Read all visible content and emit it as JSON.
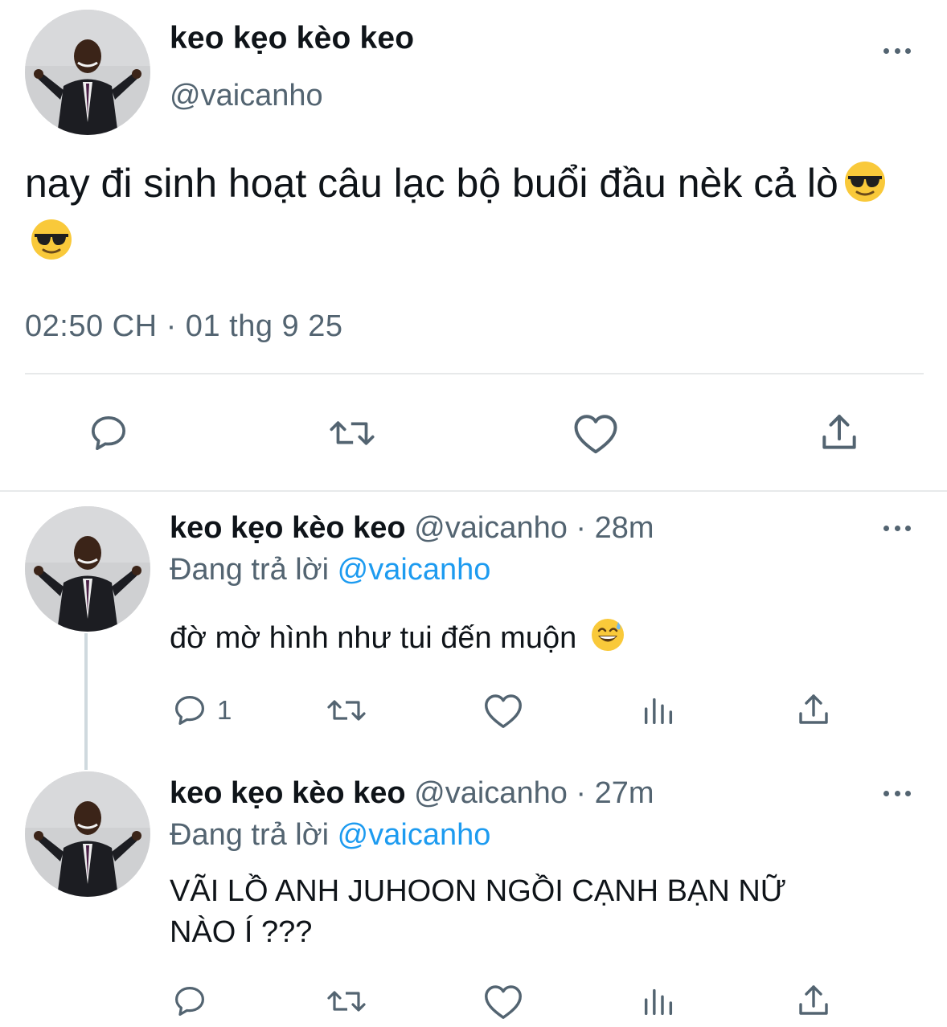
{
  "main_tweet": {
    "display_name": "keo kẹo kèo keo",
    "handle": "@vaicanho",
    "text": "nay đi sinh hoạt câu lạc bộ buổi đầu nèk cả lò",
    "emojis": [
      "smiling-face-with-sunglasses",
      "smiling-face-with-sunglasses"
    ],
    "timestamp": "02:50 CH · 01 thg 9 25",
    "actions": [
      "reply",
      "retweet",
      "like",
      "share"
    ]
  },
  "replies": [
    {
      "display_name": "keo kẹo kèo keo",
      "handle_time": "@vaicanho · 28m",
      "replying_prefix": "Đang trả lời",
      "replying_to": "@vaicanho",
      "text": "đờ mờ hình như tui đến muộn",
      "emoji": "grinning-face-with-sweat",
      "reply_count": "1",
      "actions": [
        "reply",
        "retweet",
        "like",
        "views",
        "share"
      ]
    },
    {
      "display_name": "keo kẹo kèo keo",
      "handle_time": "@vaicanho · 27m",
      "replying_prefix": "Đang trả lời",
      "replying_to": "@vaicanho",
      "text_line1": "VÃI LỒ ANH JUHOON NGỒI CẠNH BẠN NỮ",
      "text_line2": "NÀO Í ???",
      "actions": [
        "reply",
        "retweet",
        "like",
        "views",
        "share"
      ]
    }
  ],
  "colors": {
    "text": "#0f1419",
    "secondary": "#536471",
    "link": "#1d9bf0",
    "divider": "#e7e9ea",
    "thread_line": "#cfd9de"
  }
}
